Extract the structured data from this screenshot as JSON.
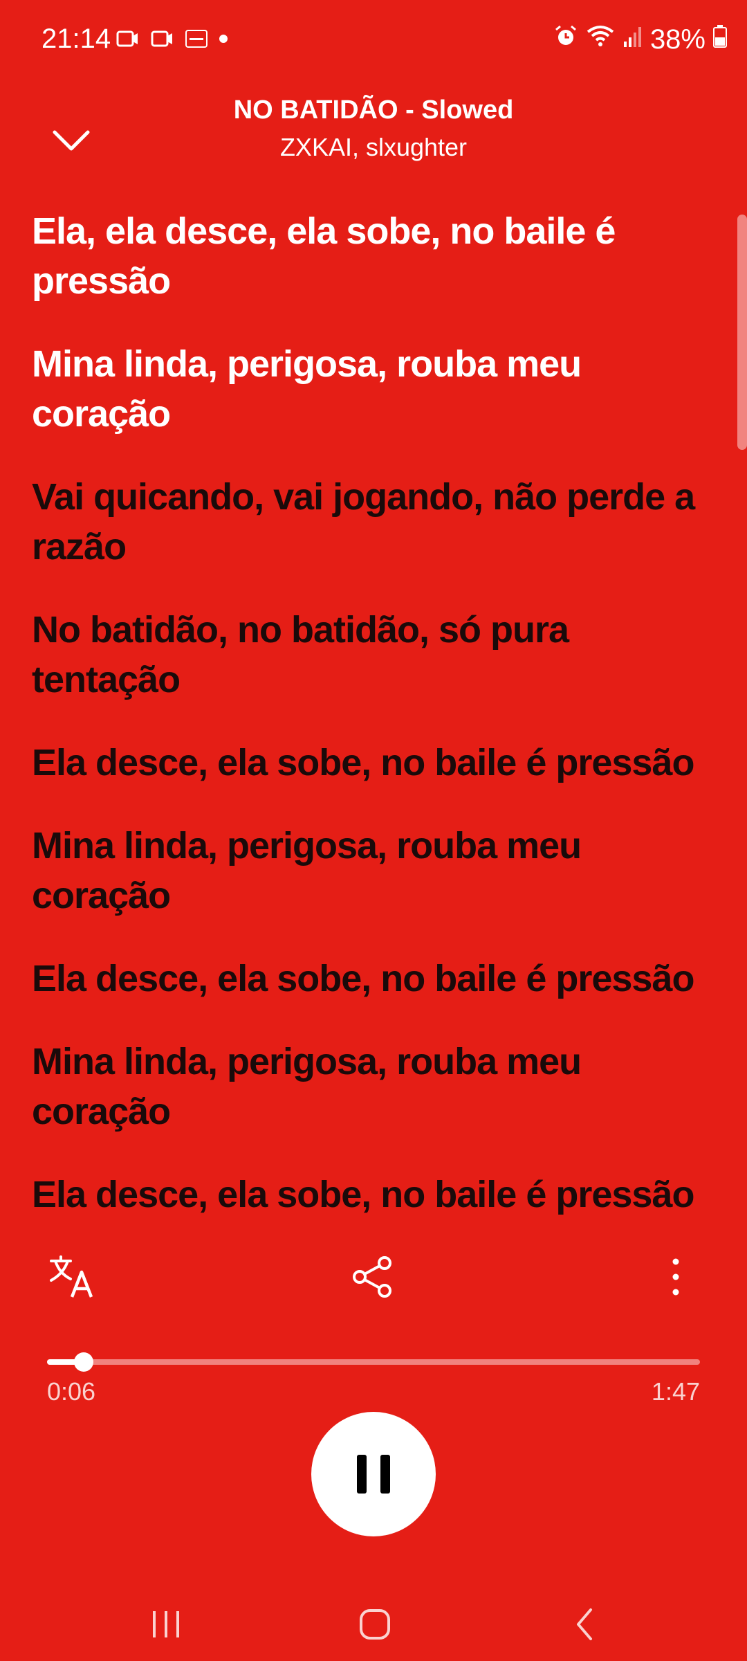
{
  "status_bar": {
    "time": "21:14",
    "battery": "38%",
    "notification_icons": [
      "screen-record-icon",
      "screen-record-icon",
      "temu-icon",
      "dot-icon"
    ],
    "system_icons": [
      "alarm-icon",
      "wifi-icon",
      "signal-icon",
      "battery-icon"
    ]
  },
  "header": {
    "title": "NO BATIDÃO - Slowed",
    "artist": "ZXKAI, slxughter"
  },
  "lyrics": [
    {
      "text": "Ela, ela desce, ela sobe, no baile é pressão",
      "state": "active"
    },
    {
      "text": "Mina linda, perigosa, rouba meu coração",
      "state": "active"
    },
    {
      "text": "Vai quicando, vai jogando, não perde a razão",
      "state": "upcoming"
    },
    {
      "text": "No batidão, no batidão, só pura tentação",
      "state": "upcoming"
    },
    {
      "text": "Ela desce, ela sobe, no baile é pressão",
      "state": "upcoming"
    },
    {
      "text": "Mina linda, perigosa, rouba meu coração",
      "state": "upcoming"
    },
    {
      "text": "Ela desce, ela sobe, no baile é pressão",
      "state": "upcoming"
    },
    {
      "text": "Mina linda, perigosa, rouba meu coração",
      "state": "upcoming"
    },
    {
      "text": "Ela desce, ela sobe, no baile é pressão",
      "state": "upcoming"
    }
  ],
  "player": {
    "elapsed": "0:06",
    "total": "1:47",
    "progress_fraction": 0.056,
    "state": "playing"
  },
  "colors": {
    "background": "#E51E16",
    "active_lyric": "#FFFFFF",
    "upcoming_lyric": "#1A0A0A"
  }
}
